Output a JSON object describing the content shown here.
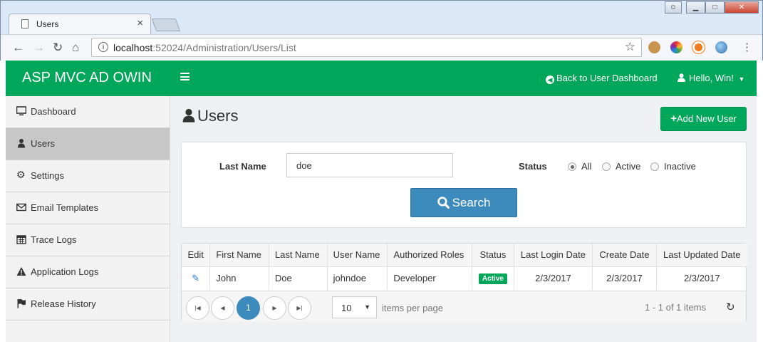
{
  "browser": {
    "tab_title": "Users",
    "close_tab": "×",
    "url_host": "localhost",
    "url_path": ":52024/Administration/Users/List"
  },
  "header": {
    "brand": "ASP MVC AD OWIN",
    "back_link": "Back to User Dashboard",
    "hello": "Hello, Win!",
    "color": "#00a659"
  },
  "sidebar": {
    "items": [
      {
        "label": "Dashboard",
        "icon": "monitor-icon"
      },
      {
        "label": "Users",
        "icon": "user-icon",
        "active": true
      },
      {
        "label": "Settings",
        "icon": "gear-icon"
      },
      {
        "label": "Email Templates",
        "icon": "envelope-icon"
      },
      {
        "label": "Trace Logs",
        "icon": "calendar-icon"
      },
      {
        "label": "Application Logs",
        "icon": "warning-icon"
      },
      {
        "label": "Release History",
        "icon": "flag-icon"
      }
    ]
  },
  "page": {
    "title": "Users",
    "add_button": "Add New User"
  },
  "filter": {
    "last_name_label": "Last Name",
    "last_name_value": "doe",
    "status_label": "Status",
    "status_options": [
      "All",
      "Active",
      "Inactive"
    ],
    "status_selected": "All",
    "search_button": "Search"
  },
  "grid": {
    "columns": [
      "Edit",
      "First Name",
      "Last Name",
      "User Name",
      "Authorized Roles",
      "Status",
      "Last Login Date",
      "Create Date",
      "Last Updated Date"
    ],
    "rows": [
      {
        "first_name": "John",
        "last_name": "Doe",
        "user_name": "johndoe",
        "roles": "Developer",
        "status": "Active",
        "last_login": "2/3/2017",
        "created": "2/3/2017",
        "updated": "2/3/2017"
      }
    ]
  },
  "pager": {
    "current_page": "1",
    "page_size": "10",
    "items_per_page": "items per page",
    "info": "1 - 1 of 1 items"
  }
}
